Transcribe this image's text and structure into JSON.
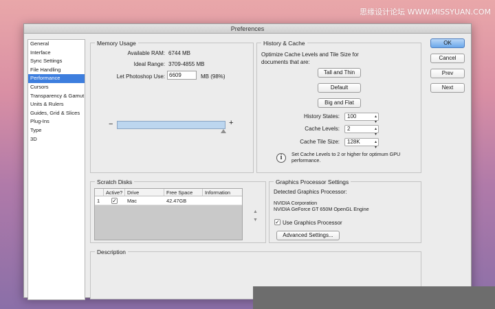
{
  "watermark": "思缘设计论坛 WWW.MISSYUAN.COM",
  "window": {
    "title": "Preferences"
  },
  "sidebar": {
    "items": [
      {
        "label": "General",
        "active": false
      },
      {
        "label": "Interface",
        "active": false
      },
      {
        "label": "Sync Settings",
        "active": false
      },
      {
        "label": "File Handling",
        "active": false
      },
      {
        "label": "Performance",
        "active": true
      },
      {
        "label": "Cursors",
        "active": false
      },
      {
        "label": "Transparency & Gamut",
        "active": false
      },
      {
        "label": "Units & Rulers",
        "active": false
      },
      {
        "label": "Guides, Grid & Slices",
        "active": false
      },
      {
        "label": "Plug-Ins",
        "active": false
      },
      {
        "label": "Type",
        "active": false
      },
      {
        "label": "3D",
        "active": false
      }
    ]
  },
  "memory": {
    "title": "Memory Usage",
    "available_label": "Available RAM:",
    "available_value": "6744 MB",
    "ideal_label": "Ideal Range:",
    "ideal_value": "3709-4855 MB",
    "let_label": "Let Photoshop Use:",
    "let_value": "6609",
    "let_unit": "MB (98%)",
    "minus": "−",
    "plus": "+",
    "slider_level": 0.98
  },
  "history": {
    "title": "History & Cache",
    "description": "Optimize Cache Levels and Tile Size for documents that are:",
    "tall_thin": "Tall and Thin",
    "default": "Default",
    "big_flat": "Big and Flat",
    "states_label": "History States:",
    "states_value": "100",
    "levels_label": "Cache Levels:",
    "levels_value": "2",
    "tile_label": "Cache Tile Size:",
    "tile_value": "128K",
    "info_text": "Set Cache Levels to 2 or higher for optimum GPU performance."
  },
  "buttons": {
    "ok": "OK",
    "cancel": "Cancel",
    "prev": "Prev",
    "next": "Next"
  },
  "scratch": {
    "title": "Scratch Disks",
    "headers": {
      "active": "Active?",
      "drive": "Drive",
      "free": "Free Space",
      "info": "Information"
    },
    "rows": [
      {
        "num": "1",
        "active": "✓",
        "drive": "Mac",
        "free": "42.47GB",
        "info": ""
      }
    ]
  },
  "gpu": {
    "title": "Graphics Processor Settings",
    "detected_label": "Detected Graphics Processor:",
    "vendor": "NVIDIA Corporation",
    "model": "NVIDIA GeForce GT 650M OpenGL Engine",
    "use_label": "Use Graphics Processor",
    "use_checked": "✓",
    "advanced": "Advanced Settings..."
  },
  "description": {
    "title": "Description"
  }
}
